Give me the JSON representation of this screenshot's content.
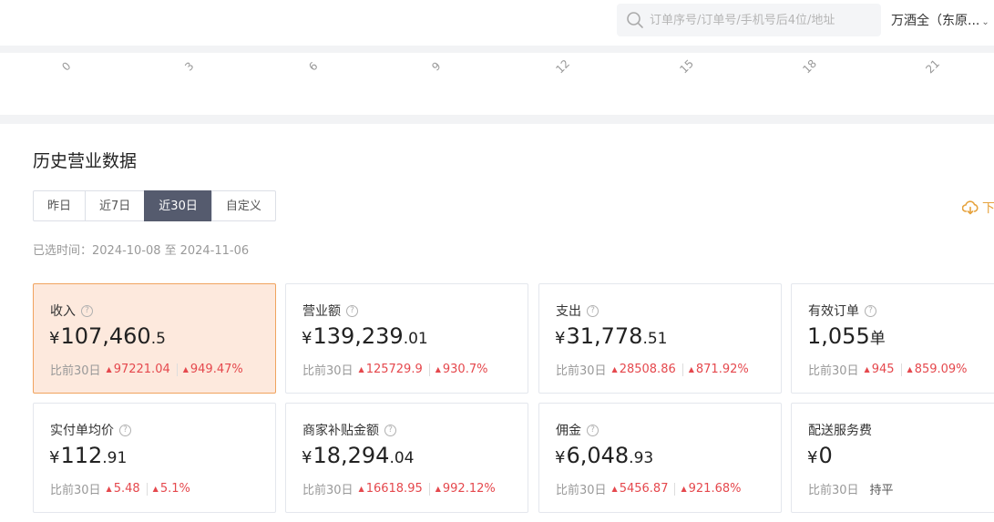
{
  "header": {
    "search_placeholder": "订单序号/订单号/手机号后4位/地址",
    "store_name": "万酒全（东原...",
    "store_chevron": "⌄"
  },
  "axis": {
    "ticks": [
      "0",
      "3",
      "6",
      "9",
      "12",
      "15",
      "18",
      "21"
    ]
  },
  "section": {
    "title": "历史营业数据",
    "tabs": [
      {
        "label": "昨日",
        "active": false
      },
      {
        "label": "近7日",
        "active": false
      },
      {
        "label": "近30日",
        "active": true
      },
      {
        "label": "自定义",
        "active": false
      }
    ],
    "download_label": "下",
    "range_label": "已选时间：",
    "range_start": "2024-10-08",
    "range_sep": "至",
    "range_end": "2024-11-06"
  },
  "cards": [
    {
      "label": "收入",
      "help": true,
      "currency": "¥",
      "int": "107,460",
      "dec": ".5",
      "unit": "",
      "cmp_label": "比前30日",
      "delta": "97221.04",
      "pct": "949.47%",
      "active": true
    },
    {
      "label": "营业额",
      "help": true,
      "currency": "¥",
      "int": "139,239",
      "dec": ".01",
      "unit": "",
      "cmp_label": "比前30日",
      "delta": "125729.9",
      "pct": "930.7%",
      "active": false
    },
    {
      "label": "支出",
      "help": true,
      "currency": "¥",
      "int": "31,778",
      "dec": ".51",
      "unit": "",
      "cmp_label": "比前30日",
      "delta": "28508.86",
      "pct": "871.92%",
      "active": false
    },
    {
      "label": "有效订单",
      "help": true,
      "currency": "",
      "int": "1,055",
      "dec": "",
      "unit": "单",
      "cmp_label": "比前30日",
      "delta": "945",
      "pct": "859.09%",
      "active": false
    },
    {
      "label": "实付单均价",
      "help": true,
      "currency": "¥",
      "int": "112",
      "dec": ".91",
      "unit": "",
      "cmp_label": "比前30日",
      "delta": "5.48",
      "pct": "5.1%",
      "active": false
    },
    {
      "label": "商家补贴金额",
      "help": true,
      "currency": "¥",
      "int": "18,294",
      "dec": ".04",
      "unit": "",
      "cmp_label": "比前30日",
      "delta": "16618.95",
      "pct": "992.12%",
      "active": false
    },
    {
      "label": "佣金",
      "help": true,
      "currency": "¥",
      "int": "6,048",
      "dec": ".93",
      "unit": "",
      "cmp_label": "比前30日",
      "delta": "5456.87",
      "pct": "921.68%",
      "active": false
    },
    {
      "label": "配送服务费",
      "help": false,
      "currency": "¥",
      "int": "0",
      "dec": "",
      "unit": "",
      "cmp_label": "比前30日",
      "flat": "持平",
      "active": false
    }
  ],
  "colors": {
    "accent": "#555b6e",
    "up": "#e5484d",
    "active_card_bg": "#fde9dd",
    "active_card_border": "#f0a35e",
    "download": "#e6a23c"
  },
  "icons": {
    "search": "search-icon",
    "download": "cloud-download-icon",
    "help": "question-circle-icon",
    "arrow_up": "arrow-up-icon"
  }
}
